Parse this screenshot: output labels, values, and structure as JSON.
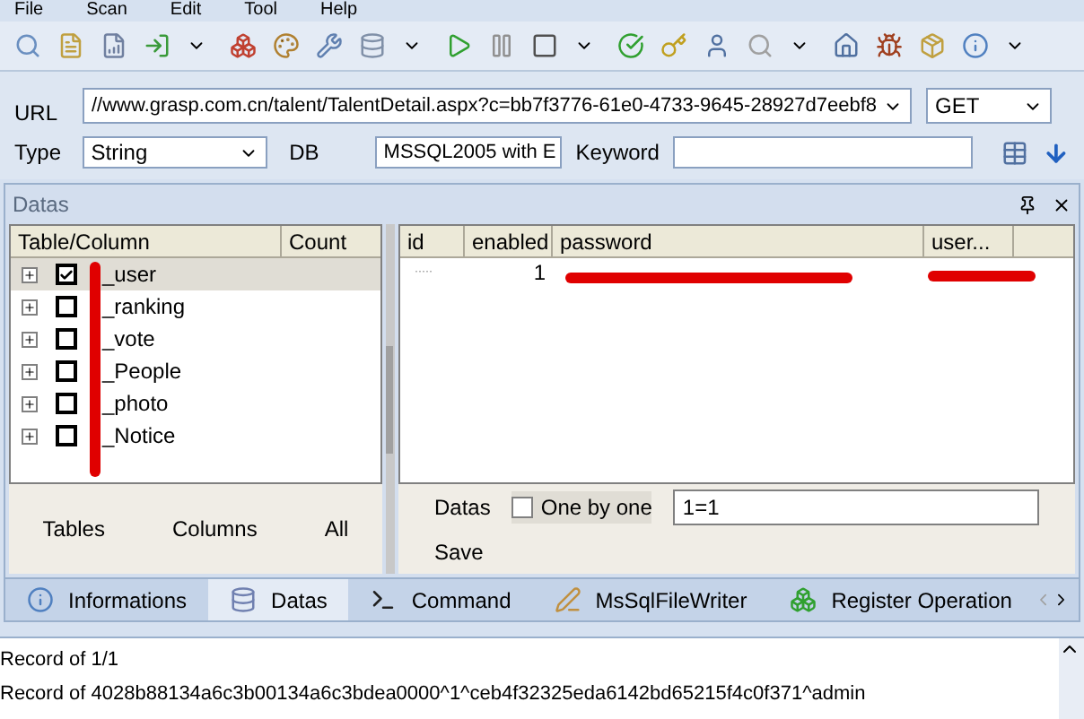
{
  "menu": [
    "File",
    "Scan",
    "Edit",
    "Tool",
    "Help"
  ],
  "url": {
    "label": "URL",
    "value": "//www.grasp.com.cn/talent/TalentDetail.aspx?c=bb7f3776-61e0-4733-9645-28927d7eebf8",
    "method": "GET"
  },
  "options": {
    "type_label": "Type",
    "type": "String",
    "db_label": "DB",
    "db": "MSSQL2005 with E",
    "keyword_label": "Keyword"
  },
  "panel": {
    "title": "Datas"
  },
  "tree": {
    "columns": [
      "Table/Column",
      "Count"
    ],
    "items": [
      {
        "name": "_user",
        "checked": true,
        "selected": true
      },
      {
        "name": "_ranking",
        "checked": false,
        "selected": false
      },
      {
        "name": "_vote",
        "checked": false,
        "selected": false
      },
      {
        "name": "_People",
        "checked": false,
        "selected": false
      },
      {
        "name": "_photo",
        "checked": false,
        "selected": false
      },
      {
        "name": "_Notice",
        "checked": false,
        "selected": false
      }
    ],
    "buttons": [
      "Tables",
      "Columns",
      "All"
    ]
  },
  "grid": {
    "columns": [
      "id",
      "enabled",
      "password",
      "user..."
    ],
    "rows": [
      {
        "id": "·····",
        "enabled": "1"
      }
    ]
  },
  "query": {
    "label": "Datas",
    "one_by_one": {
      "label": "One by one",
      "checked": false
    },
    "condition": "1=1",
    "save": "Save"
  },
  "tabs": [
    {
      "label": "Informations",
      "selected": false
    },
    {
      "label": "Datas",
      "selected": true
    },
    {
      "label": "Command",
      "selected": false
    },
    {
      "label": "MsSqlFileWriter",
      "selected": false
    },
    {
      "label": "Register Operation",
      "selected": false
    }
  ],
  "log": [
    "Record of 1/1",
    "Record of 4028b88134a6c3b00134a6c3bdea0000^1^ceb4f32325eda6142bd65215f4c0f371^admin"
  ]
}
